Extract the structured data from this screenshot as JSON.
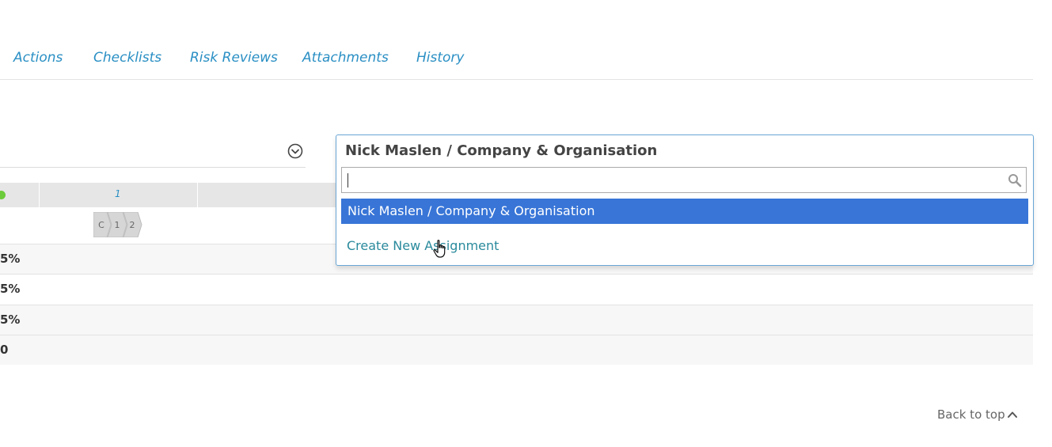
{
  "tabs": [
    {
      "label": "Actions"
    },
    {
      "label": "Checklists"
    },
    {
      "label": "Risk Reviews"
    },
    {
      "label": "Attachments"
    },
    {
      "label": "History"
    }
  ],
  "grid": {
    "column_number": "1",
    "stages": [
      "C",
      "1",
      "2"
    ],
    "rows": [
      {
        "value": "5%"
      },
      {
        "value": "5%"
      },
      {
        "value": "5%"
      },
      {
        "value": "0"
      }
    ],
    "status_color": "#6ccb3a"
  },
  "assignment_select": {
    "selected_value": "Nick Maslen / Company & Organisation",
    "search_value": "",
    "options": [
      {
        "label": "Nick Maslen / Company & Organisation",
        "highlighted": true
      }
    ],
    "create_link": "Create New Assignment",
    "highlight_color": "#3875d7"
  },
  "footer": {
    "back_to_top": "Back to top"
  },
  "colors": {
    "tab_link": "#2a8fc4",
    "create_link": "#2a8a9c",
    "panel_border": "#6aa6d6"
  }
}
